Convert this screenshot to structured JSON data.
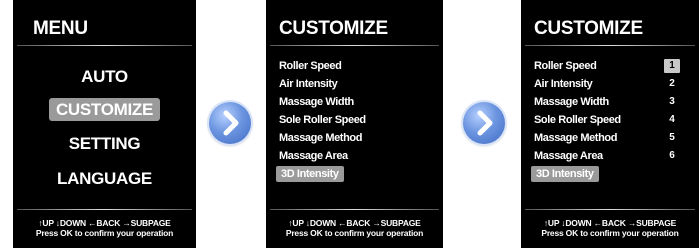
{
  "screen1": {
    "title": "MENU",
    "items": [
      {
        "label": "AUTO",
        "selected": false
      },
      {
        "label": "CUSTOMIZE",
        "selected": true
      },
      {
        "label": "SETTING",
        "selected": false
      },
      {
        "label": "LANGUAGE",
        "selected": false
      }
    ],
    "footer_line1": "↑UP ↓DOWN ←BACK →SUBPAGE",
    "footer_line2": "Press OK to confirm your operation"
  },
  "screen2": {
    "title": "CUSTOMIZE",
    "items": [
      {
        "label": "Roller Speed"
      },
      {
        "label": "Air Intensity"
      },
      {
        "label": "Massage Width"
      },
      {
        "label": "Sole Roller Speed"
      },
      {
        "label": "Massage Method"
      },
      {
        "label": "Massage Area"
      },
      {
        "label": "3D Intensity",
        "selected": true
      }
    ],
    "footer_line1": "↑UP ↓DOWN ←BACK →SUBPAGE",
    "footer_line2": "Press OK to confirm your operation"
  },
  "screen3": {
    "title": "CUSTOMIZE",
    "items": [
      {
        "label": "Roller Speed",
        "value": "1",
        "value_selected": true
      },
      {
        "label": "Air Intensity",
        "value": "2"
      },
      {
        "label": "Massage Width",
        "value": "3"
      },
      {
        "label": "Sole Roller Speed",
        "value": "4"
      },
      {
        "label": "Massage Method",
        "value": "5"
      },
      {
        "label": "Massage Area",
        "value": "6"
      },
      {
        "label": "3D Intensity",
        "selected": true
      }
    ],
    "footer_line1": "↑UP ↓DOWN ←BACK →SUBPAGE",
    "footer_line2": "Press OK to confirm your operation"
  },
  "arrows": [
    {
      "icon": "chevron-right-icon"
    },
    {
      "icon": "chevron-right-icon"
    }
  ],
  "colors": {
    "screen_bg": "#000000",
    "highlight": "#9a9a9a",
    "value_highlight": "#c8c8c8",
    "arrow_blue": "#5b86d6"
  }
}
